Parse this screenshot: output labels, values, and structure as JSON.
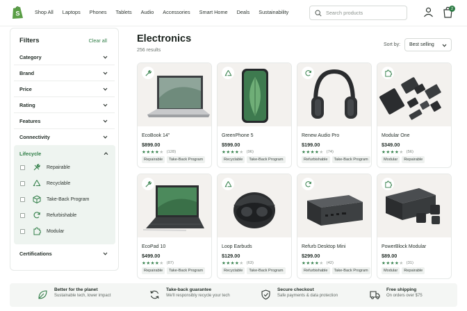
{
  "colors": {
    "accent": "#2f7d46",
    "card_bg": "#f3f1ee",
    "footer_bg": "#f4f6f4"
  },
  "nav": [
    "Shop All",
    "Laptops",
    "Phones",
    "Tablets",
    "Audio",
    "Accessories",
    "Smart Home",
    "Deals",
    "Sustainability"
  ],
  "search": {
    "placeholder": "Search products"
  },
  "cart": {
    "count": "2"
  },
  "filters": {
    "title": "Filters",
    "clear": "Clear all",
    "sections": [
      "Category",
      "Brand",
      "Price",
      "Rating",
      "Features",
      "Connectivity"
    ],
    "lifecycle": {
      "title": "Lifecycle",
      "items": [
        {
          "label": "Repairable",
          "icon": "wrench-icon"
        },
        {
          "label": "Recyclable",
          "icon": "recycle-icon"
        },
        {
          "label": "Take-Back Program",
          "icon": "box-icon"
        },
        {
          "label": "Refurbishable",
          "icon": "refresh-icon"
        },
        {
          "label": "Modular",
          "icon": "puzzle-icon"
        }
      ]
    },
    "certifications": "Certifications"
  },
  "main": {
    "title": "Electronics",
    "count": "256 results",
    "sort_label": "Sort by:",
    "sort_value": "Best selling"
  },
  "products": [
    {
      "name": "EcoBook 14\"",
      "price": "$899.00",
      "rating": 4,
      "reviews": "(128)",
      "tags": [
        "Repairable",
        "Take-Back Program"
      ],
      "badge": "wrench-icon",
      "image": "laptop"
    },
    {
      "name": "GreenPhone 5",
      "price": "$599.00",
      "rating": 4,
      "reviews": "(96)",
      "tags": [
        "Recyclable",
        "Take-Back Program"
      ],
      "badge": "recycle-icon",
      "image": "phone"
    },
    {
      "name": "Renew Audio Pro",
      "price": "$199.00",
      "rating": 4,
      "reviews": "(74)",
      "tags": [
        "Refurbishable",
        "Take-Back Program"
      ],
      "badge": "refresh-icon",
      "image": "headphones"
    },
    {
      "name": "Modular One",
      "price": "$349.00",
      "rating": 4,
      "reviews": "(56)",
      "tags": [
        "Modular",
        "Repairable"
      ],
      "badge": "puzzle-icon",
      "image": "modules"
    },
    {
      "name": "EcoPad 10",
      "price": "$499.00",
      "rating": 4,
      "reviews": "(87)",
      "tags": [
        "Repairable",
        "Take-Back Program"
      ],
      "badge": "wrench-icon",
      "image": "tablet"
    },
    {
      "name": "Loop Earbuds",
      "price": "$129.00",
      "rating": 4,
      "reviews": "(63)",
      "tags": [
        "Recyclable",
        "Take-Back Program"
      ],
      "badge": "recycle-icon",
      "image": "earbuds"
    },
    {
      "name": "Refurb Desktop Mini",
      "price": "$299.00",
      "rating": 4,
      "reviews": "(42)",
      "tags": [
        "Refurbishable",
        "Take-Back Program"
      ],
      "badge": "refresh-icon",
      "image": "desktop"
    },
    {
      "name": "PowerBlock Modular",
      "price": "$89.00",
      "rating": 4,
      "reviews": "(31)",
      "tags": [
        "Modular",
        "Repairable"
      ],
      "badge": "puzzle-icon",
      "image": "powerbank"
    }
  ],
  "footer": [
    {
      "title": "Better for the planet",
      "sub": "Sustainable tech, lower impact",
      "icon": "leaf-icon"
    },
    {
      "title": "Take-back guarantee",
      "sub": "We'll responsibly recycle your tech",
      "icon": "recycle-icon"
    },
    {
      "title": "Secure checkout",
      "sub": "Safe payments & data protection",
      "icon": "shield-icon"
    },
    {
      "title": "Free shipping",
      "sub": "On orders over $75",
      "icon": "truck-icon"
    }
  ]
}
